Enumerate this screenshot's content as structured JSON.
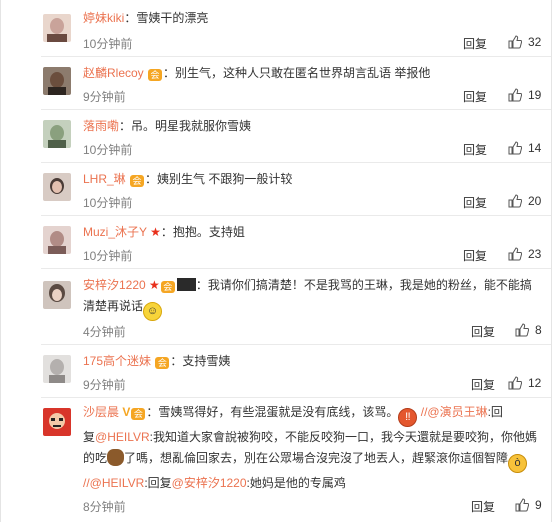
{
  "comments": [
    {
      "user": "婷妹kiki",
      "text": "：雪姨干的漂亮",
      "time": "10分钟前",
      "reply": "回复",
      "likes": "32",
      "avatar_color": "#c9a39a"
    },
    {
      "user": "赵麟Rlecoy",
      "badge": "会",
      "text": "：别生气，这种人只敢在匿名世界胡言乱语 举报他",
      "time": "9分钟前",
      "reply": "回复",
      "likes": "19",
      "avatar_color": "#6b4e3d"
    },
    {
      "user": "落雨嘞",
      "text": "：吊。明星我就服你雪姨",
      "time": "10分钟前",
      "reply": "回复",
      "likes": "14",
      "avatar_color": "#8aa07e"
    },
    {
      "user": "LHR_琳",
      "badge": "会",
      "text": "：姨别生气 不跟狗一般计较",
      "time": "10分钟前",
      "reply": "回复",
      "likes": "20",
      "avatar_color": "#4a3b36"
    },
    {
      "user": "Muzi_沐子Y",
      "text": "：抱抱。支持姐",
      "time": "10分钟前",
      "reply": "回复",
      "likes": "23",
      "avatar_color": "#b18c86"
    },
    {
      "user": "安梓汐1220",
      "badge": "会",
      "text_line1": "：我请你们搞清楚！不是我骂的王琳，我是她的粉丝，能不能搞",
      "text_line2": "清楚再说话",
      "time": "4分钟前",
      "reply": "回复",
      "likes": "8",
      "avatar_color": "#5a4a42"
    },
    {
      "user": "175高个迷妹",
      "badge": "会",
      "text": "：支持雪姨",
      "time": "9分钟前",
      "reply": "回复",
      "likes": "12",
      "avatar_color": "#b4b0ae"
    },
    {
      "user": "沙层晨",
      "vip": "V",
      "badge": "会",
      "text_a": "：雪姨骂得好，有些混蛋就是没有底线，该骂。",
      "mention1": "//@演员王琳",
      "text_b": ":回",
      "line2_a": "复",
      "mention2": "@HEILVR",
      "line2_b": ":我知道大家會說被狗咬，不能反咬狗一口，我今天還就是要咬狗，你他媽",
      "line3": "的吃",
      "line3_b": "了嗎，想亂倫回家去，別在公眾場合沒完沒了地丟人，趕緊滾你這個智障",
      "mention3": "//@HEILVR",
      "line4_a": ":回复",
      "mention4": "@安梓汐1220",
      "line4_b": ":她妈是他的专属鸡",
      "time": "8分钟前",
      "reply": "回复",
      "likes": "9",
      "avatar_color": "#d8352a"
    }
  ]
}
